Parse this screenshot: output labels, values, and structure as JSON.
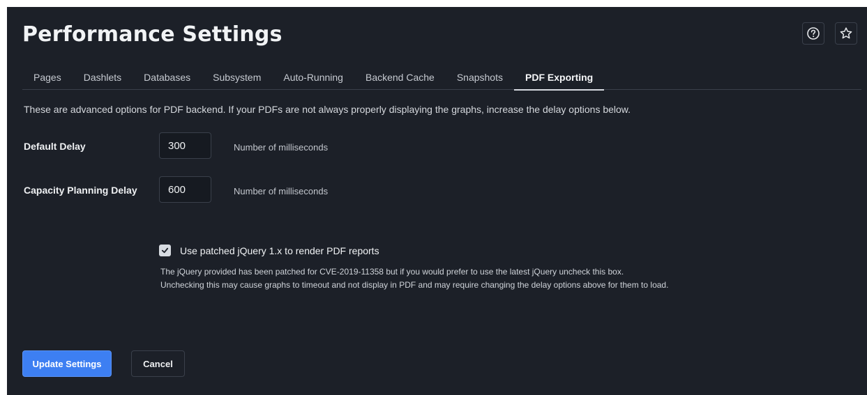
{
  "header": {
    "title": "Performance Settings",
    "icons": [
      "help-icon",
      "star-icon"
    ]
  },
  "tabs": [
    {
      "label": "Pages",
      "active": false
    },
    {
      "label": "Dashlets",
      "active": false
    },
    {
      "label": "Databases",
      "active": false
    },
    {
      "label": "Subsystem",
      "active": false
    },
    {
      "label": "Auto-Running",
      "active": false
    },
    {
      "label": "Backend Cache",
      "active": false
    },
    {
      "label": "Snapshots",
      "active": false
    },
    {
      "label": "PDF Exporting",
      "active": true
    }
  ],
  "intro": "These are advanced options for PDF backend. If your PDFs are not always properly displaying the graphs, increase the delay options below.",
  "fields": {
    "default_delay": {
      "label": "Default Delay",
      "value": "300",
      "help": "Number of milliseconds"
    },
    "capacity_delay": {
      "label": "Capacity Planning Delay",
      "value": "600",
      "help": "Number of milliseconds"
    }
  },
  "jquery_option": {
    "label": "Use patched jQuery 1.x to render PDF reports",
    "checked": true,
    "note_line1": "The jQuery provided has been patched for CVE-2019-11358 but if you would prefer to use the latest jQuery uncheck this box.",
    "note_line2": "Unchecking this may cause graphs to timeout and not display in PDF and may require changing the delay options above for them to load."
  },
  "actions": {
    "update_label": "Update Settings",
    "cancel_label": "Cancel"
  },
  "colors": {
    "background": "#1c2028",
    "accent": "#3d7ff2",
    "border": "#3a404b"
  }
}
